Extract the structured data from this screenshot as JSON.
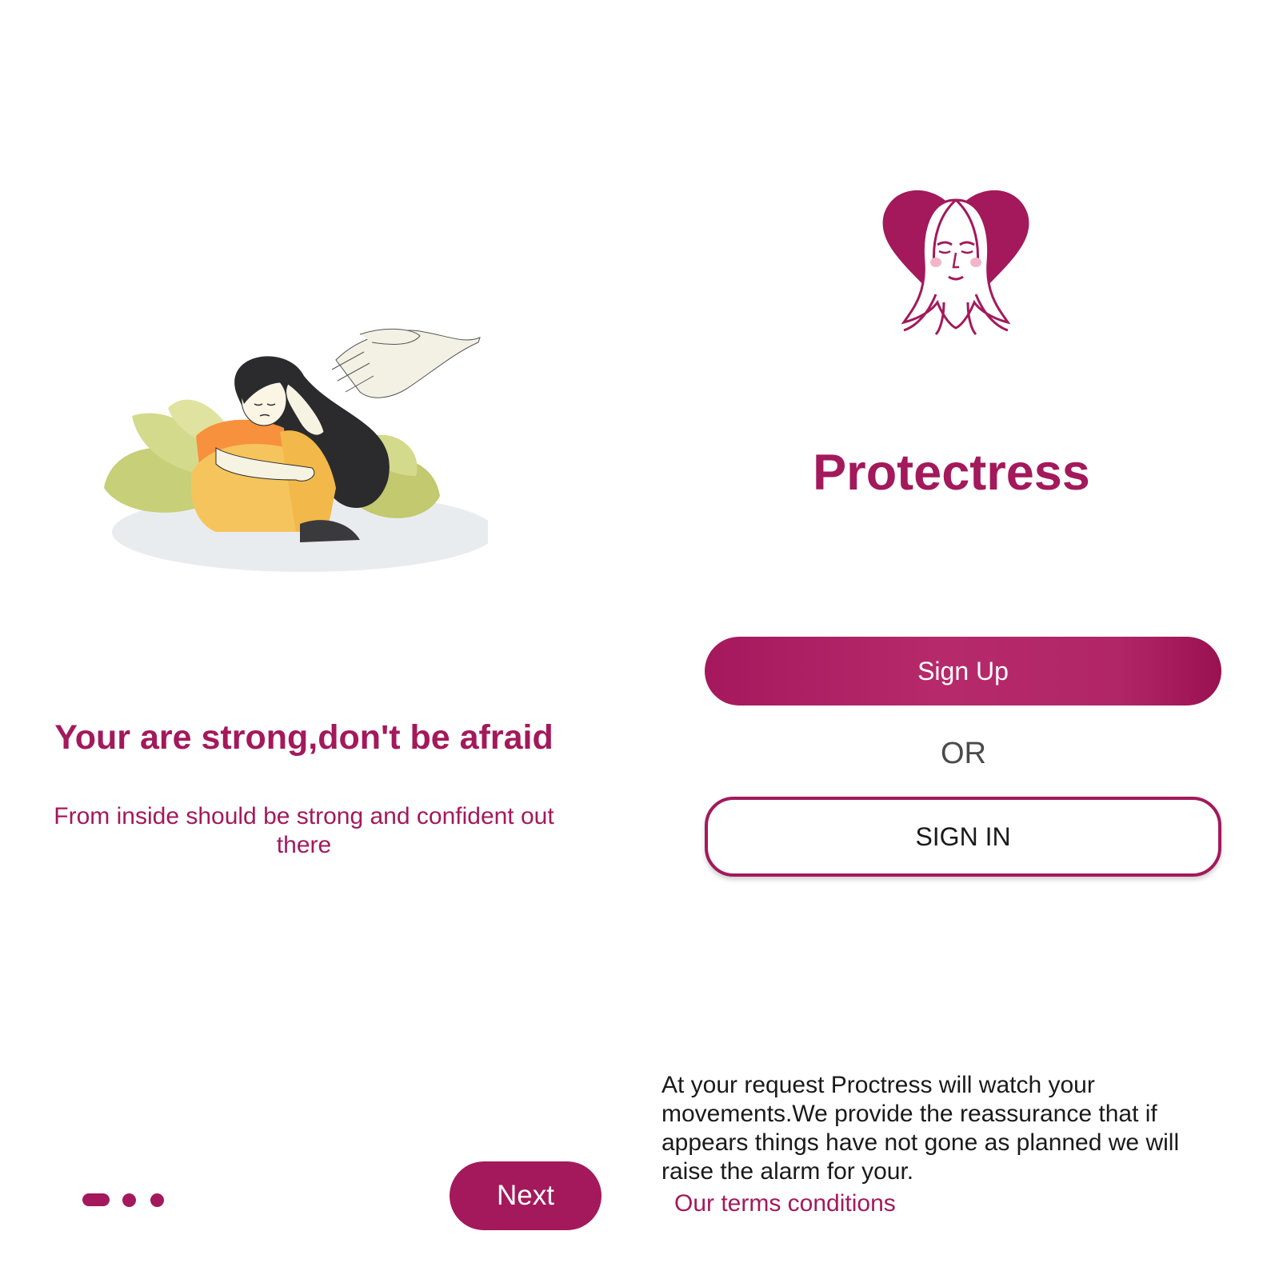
{
  "onboarding": {
    "headline": "Your are strong,don't be afraid",
    "subline": "From inside should be strong and confident out there",
    "pager": {
      "total": 3,
      "active_index": 0
    },
    "next_label": "Next"
  },
  "welcome": {
    "app_title": "Protectress",
    "signup_label": "Sign Up",
    "or_label": "OR",
    "signin_label": "SIGN IN",
    "disclaimer": "At your request Proctress will watch your movements.We provide the reassurance that if appears things have not gone as planned we will raise the alarm for your.",
    "terms_link": "Our terms conditions"
  },
  "colors": {
    "brand": "#a3195b",
    "text_dark": "#1a1a1a",
    "text_muted": "#4a4a4a",
    "background": "#ffffff"
  },
  "icons": {
    "illustration": "distressed-woman-illustration",
    "logo": "woman-face-heart-logo"
  }
}
